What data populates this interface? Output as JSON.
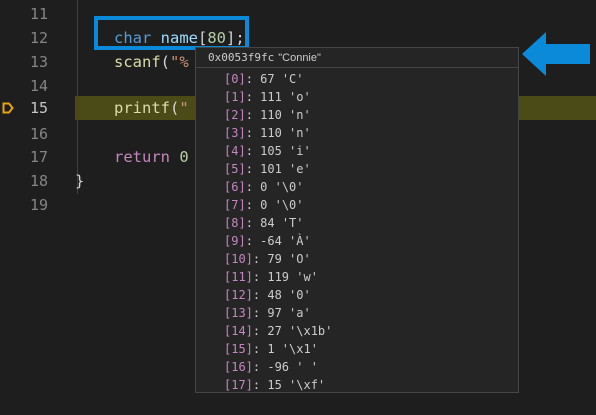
{
  "editor": {
    "line_numbers": [
      "11",
      "12",
      "13",
      "14",
      "15",
      "16",
      "17",
      "18",
      "19"
    ],
    "active_line": "15",
    "lines": {
      "l12_kw": "char",
      "l12_var": "name",
      "l12_open": "[",
      "l12_num": "80",
      "l12_close": "];",
      "l13_fn": "scanf",
      "l13_open": "(",
      "l13_str": "\"%",
      "l15_fn": "printf",
      "l15_open": "(",
      "l15_str": "\"",
      "l17_kw": "return",
      "l17_num": "0",
      "l18_brace": "}"
    }
  },
  "hover": {
    "address": "0x0053f9fc",
    "value": "\"Connie\"",
    "items": [
      {
        "index": "[0]",
        "value": "67 'C'"
      },
      {
        "index": "[1]",
        "value": "111 'o'"
      },
      {
        "index": "[2]",
        "value": "110 'n'"
      },
      {
        "index": "[3]",
        "value": "110 'n'"
      },
      {
        "index": "[4]",
        "value": "105 'i'"
      },
      {
        "index": "[5]",
        "value": "101 'e'"
      },
      {
        "index": "[6]",
        "value": "0 '\\0'"
      },
      {
        "index": "[7]",
        "value": "0 '\\0'"
      },
      {
        "index": "[8]",
        "value": "84 'T'"
      },
      {
        "index": "[9]",
        "value": "-64 'À'"
      },
      {
        "index": "[10]",
        "value": "79 'O'"
      },
      {
        "index": "[11]",
        "value": "119 'w'"
      },
      {
        "index": "[12]",
        "value": "48 '0'"
      },
      {
        "index": "[13]",
        "value": "97 'a'"
      },
      {
        "index": "[14]",
        "value": "27 '\\x1b'"
      },
      {
        "index": "[15]",
        "value": "1 '\\x1'"
      },
      {
        "index": "[16]",
        "value": "-96 ' '"
      },
      {
        "index": "[17]",
        "value": "15 '\\xf'"
      }
    ]
  },
  "colors": {
    "callout": "#0a8ad8",
    "breakpoint_arrow": "#e8a317",
    "current_line": "#4b4b18"
  },
  "icons": {
    "breakpoint": "debug-breakpoint-arrow-icon",
    "annotation": "left-pointing-arrow-icon"
  }
}
